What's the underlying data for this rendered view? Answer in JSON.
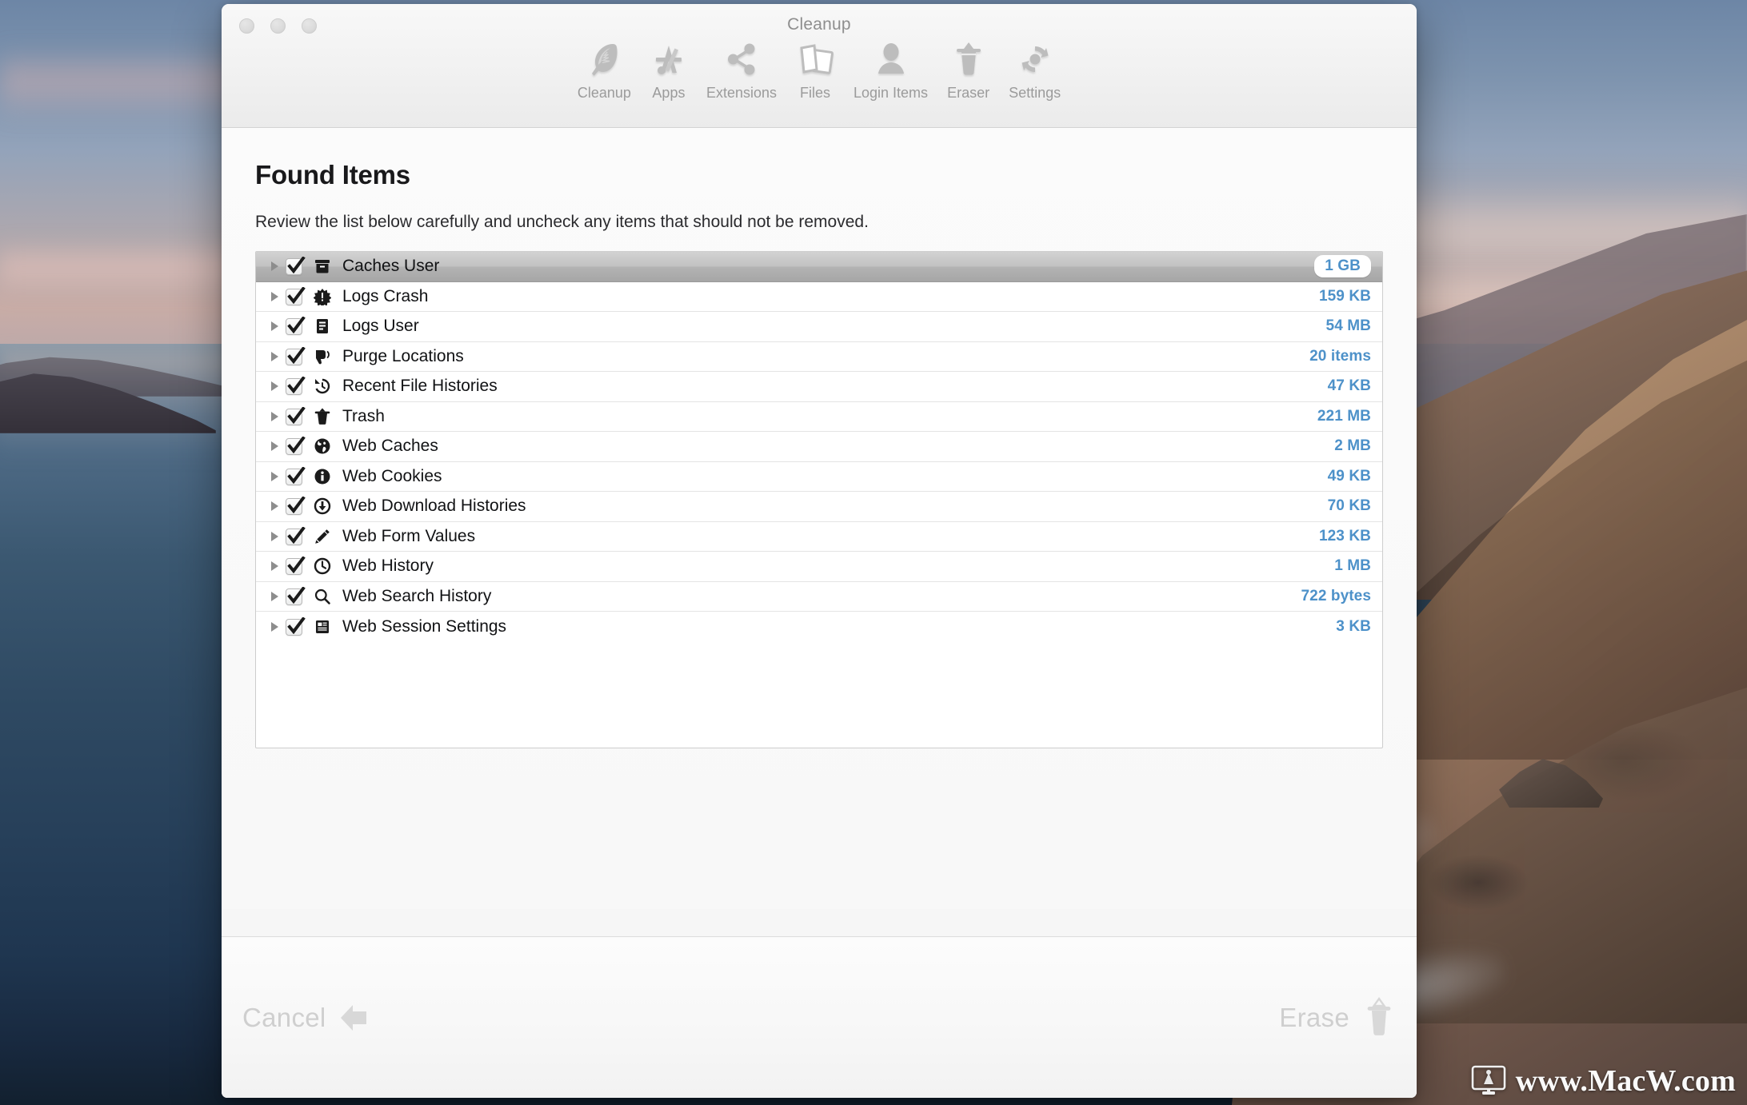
{
  "window": {
    "title": "Cleanup",
    "traffic_lights": [
      "close",
      "minimize",
      "zoom"
    ]
  },
  "toolbar": {
    "items": [
      {
        "label": "Cleanup",
        "icon": "feather-icon"
      },
      {
        "label": "Apps",
        "icon": "app-store-icon"
      },
      {
        "label": "Extensions",
        "icon": "share-nodes-icon"
      },
      {
        "label": "Files",
        "icon": "files-icon"
      },
      {
        "label": "Login Items",
        "icon": "user-icon"
      },
      {
        "label": "Eraser",
        "icon": "trash-icon"
      },
      {
        "label": "Settings",
        "icon": "sync-gear-icon"
      }
    ]
  },
  "main": {
    "title": "Found Items",
    "subtitle": "Review the list below carefully and uncheck any items that should not be removed."
  },
  "list": {
    "rows": [
      {
        "label": "Caches User",
        "value": "1 GB",
        "icon": "archive-box-icon",
        "checked": true,
        "selected": true
      },
      {
        "label": "Logs Crash",
        "value": "159 KB",
        "icon": "crash-burst-icon",
        "checked": true,
        "selected": false
      },
      {
        "label": "Logs User",
        "value": "54 MB",
        "icon": "document-lines-icon",
        "checked": true,
        "selected": false
      },
      {
        "label": "Purge Locations",
        "value": "20 items",
        "icon": "thumbs-down-icon",
        "checked": true,
        "selected": false
      },
      {
        "label": "Recent File Histories",
        "value": "47 KB",
        "icon": "clock-rewind-icon",
        "checked": true,
        "selected": false
      },
      {
        "label": "Trash",
        "value": "221 MB",
        "icon": "trash-can-icon",
        "checked": true,
        "selected": false
      },
      {
        "label": "Web Caches",
        "value": "2 MB",
        "icon": "globe-icon",
        "checked": true,
        "selected": false
      },
      {
        "label": "Web Cookies",
        "value": "49 KB",
        "icon": "info-circle-icon",
        "checked": true,
        "selected": false
      },
      {
        "label": "Web Download Histories",
        "value": "70 KB",
        "icon": "download-circle-icon",
        "checked": true,
        "selected": false
      },
      {
        "label": "Web Form Values",
        "value": "123 KB",
        "icon": "pencil-icon",
        "checked": true,
        "selected": false
      },
      {
        "label": "Web History",
        "value": "1 MB",
        "icon": "clock-icon",
        "checked": true,
        "selected": false
      },
      {
        "label": "Web Search History",
        "value": "722 bytes",
        "icon": "magnifier-icon",
        "checked": true,
        "selected": false
      },
      {
        "label": "Web Session Settings",
        "value": "3 KB",
        "icon": "news-card-icon",
        "checked": true,
        "selected": false
      }
    ]
  },
  "footer": {
    "cancel_label": "Cancel",
    "cancel_icon": "back-arrow-icon",
    "erase_label": "Erase",
    "erase_icon": "trash-icon"
  },
  "watermark": {
    "text": "www.MacW.com",
    "icon": "imac-monitor-icon"
  },
  "colors": {
    "value_blue": "#4d91c9",
    "toolbar_label": "#9b9b9b",
    "title_text": "#19191b",
    "footer_label": "#cfcfcf",
    "selection_gray": "#b3b3b3"
  }
}
